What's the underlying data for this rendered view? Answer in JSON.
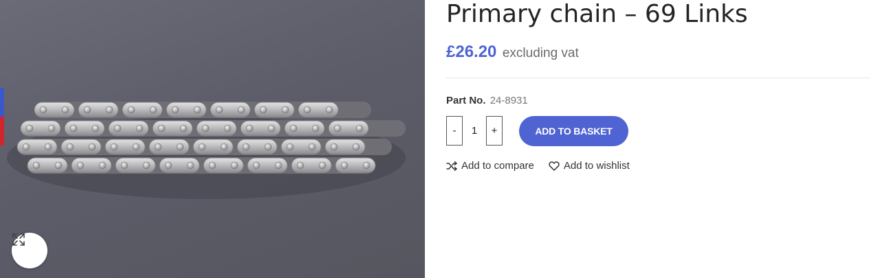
{
  "product": {
    "image_alt": "Primary chain product photo",
    "title": "Primary chain – 69 Links",
    "price": "£26.20",
    "price_suffix": "excluding vat",
    "part_no_label": "Part No.",
    "part_no_value": "24-8931"
  },
  "quantity": {
    "minus_label": "-",
    "value": "1",
    "plus_label": "+"
  },
  "buttons": {
    "add_to_basket": "ADD TO BASKET"
  },
  "links": {
    "compare": "Add to compare",
    "wishlist": "Add to wishlist"
  },
  "icons": {
    "zoom": "expand-icon",
    "compare": "shuffle-icon",
    "wishlist": "heart-icon"
  },
  "colors": {
    "accent": "#4f63d2",
    "title": "#242424",
    "muted": "#777777"
  }
}
